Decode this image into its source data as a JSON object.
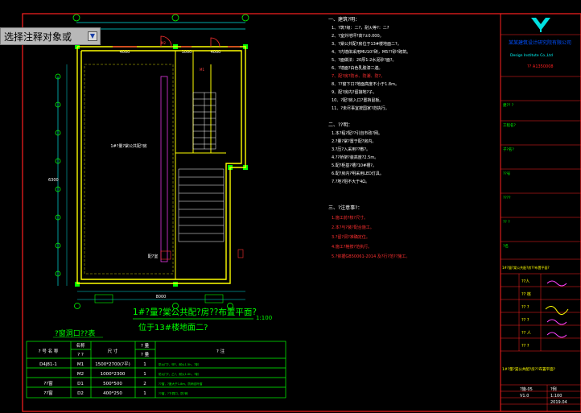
{
  "window": {
    "selection_prompt": "选择注释对象或"
  },
  "icons": {
    "prompt_button": "expand-icon"
  },
  "colors": {
    "background": "#000000",
    "frame": "#ff2020",
    "wall": "#ffff00",
    "dim": "#00e0e0",
    "structure": "#00ff00",
    "notes": "#ffffff",
    "highlight": "#ff3030"
  },
  "plan": {
    "title": "1#?量?棠公共配?房??布置平面?",
    "scale": "1:100",
    "subtitle": "位于13#楼地面二?",
    "room_label": "1#?量?棠公共配?房",
    "pump_label": "配?室",
    "dims": {
      "top_left": "4000",
      "top_mid": "1000",
      "top_right": "4000",
      "side": "6300",
      "bottom": "8000"
    }
  },
  "door_table": {
    "title": "?窗洞口??表",
    "headers": [
      "? 号 名 称",
      "名称",
      "尺 寸",
      "? 量",
      "? 注"
    ],
    "header_sub": [
      "",
      "? ?",
      "",
      "? 量",
      ""
    ],
    "rows": [
      {
        "code": "D4J81-1",
        "name": "M1",
        "size": "1500*2700(?平)",
        "qty": "1",
        "note": "防火门?，甲?，耐火1.5h，?制"
      },
      {
        "code": "",
        "name": "M2",
        "size": "1000*2300",
        "qty": "1",
        "note": "防火门?，乙?，耐火1.0h，?制"
      },
      {
        "code": "??窗",
        "name": "D1",
        "size": "500*500",
        "qty": "2",
        "note": "??窗，?度大于1.8m，防雨百叶窗"
      },
      {
        "code": "??窗",
        "name": "D2",
        "size": "400*250",
        "qty": "1",
        "note": "??窗，?下洞口，防?网"
      }
    ]
  },
  "notes": {
    "section1_title": "一、建筑?明：",
    "section1": [
      "1、?筑?级：二?，耐火等?：二?",
      "2、?室外地坪?高?±0.000。",
      "3、?棠公共配?房位于13#楼地面二?。",
      "4、?内墙体采用MU10?砖，M5??砂?砌筑。",
      "5、?面做法：20厚1:2水泥砂?面?。",
      "6、?墙面?白色乳胶漆二遍。",
      "7、配?房?防水、防潮、防?。",
      "8、??窗下口?地面高度不小于1.8m。",
      "9、配?房内?留接地?子。",
      "10、?配?房入口?置挡鼠板。",
      "11、?未尽事宜按国家?范执行。"
    ],
    "section2_title": "二、??明：",
    "section2": [
      "1.本?程?配??引自市政?网。",
      "2.?量?棠?置于配?房内。",
      "3.?压?入采用??敷?。",
      "4.??桥架?装高度?2.5m。",
      "5.配?柜基?槽?10#槽?。",
      "6.配?房内?明采用LED灯具。",
      "7.?地?阻不大于4Ω。"
    ],
    "section3_title": "三、?注意事?：",
    "section3": [
      "1.施工前?核?尺寸。",
      "2.本?与?装?配合施工。",
      "3.?留?洞?准确定位。",
      "4.施工?格按?范执行。",
      "5.?依据GB50061-2014 及?行?范??施工。"
    ]
  },
  "title_block": {
    "company_cn": "某某建筑设计研究院有限公司",
    "company_en": "Design Institute Co.,Ltd",
    "license": "?? A1350008",
    "fields": [
      "建?? ?",
      "工程名?",
      "子?名?",
      "??号",
      "????",
      "?? ?",
      "?名"
    ],
    "drawing_name": "1#?量?棠公共配?房??布置平面?",
    "roles": [
      "??人",
      "?? 核",
      "?? ?",
      "?? ?",
      "?? 人",
      "?? ?"
    ],
    "sheet_no": "?施-05",
    "version": "V1.0",
    "date": "2019.04",
    "scale_label": "?例",
    "scale_value": "1:100"
  }
}
